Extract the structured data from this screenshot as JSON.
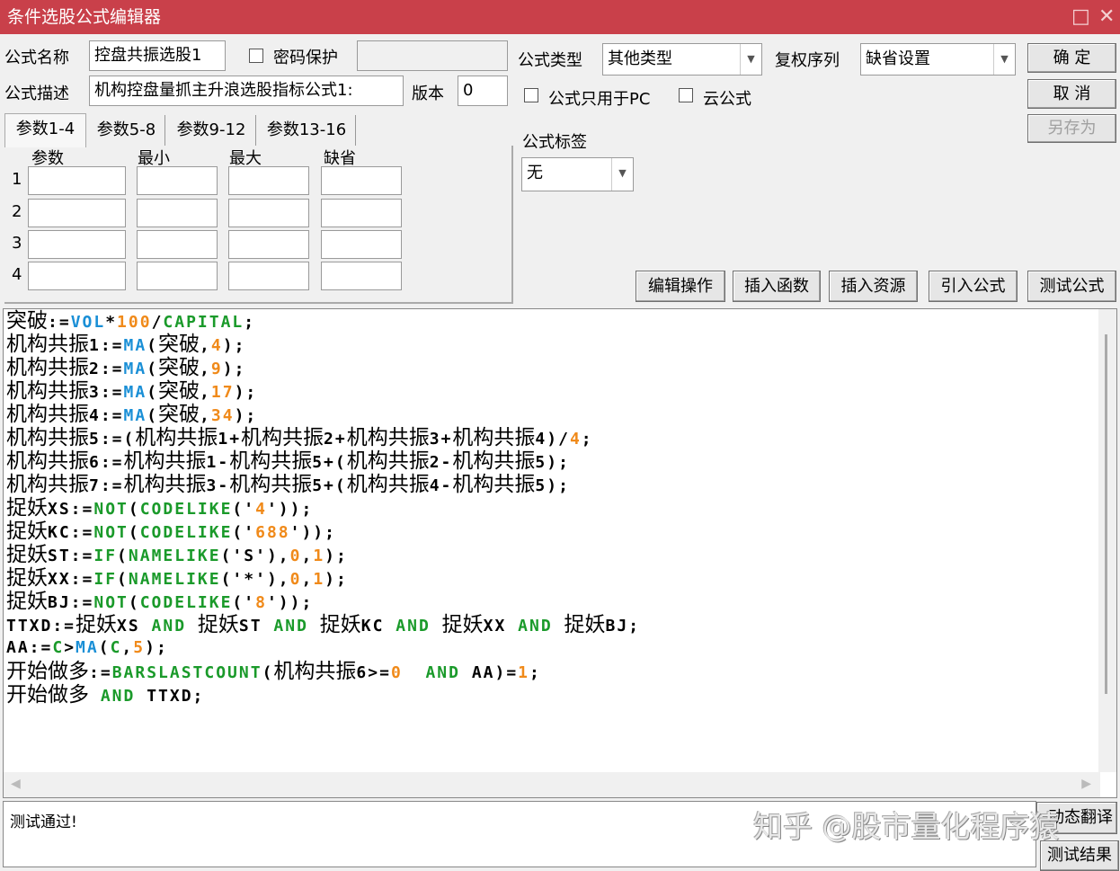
{
  "window": {
    "title": "条件选股公式编辑器",
    "restore_icon": "□",
    "close_icon": "✕"
  },
  "form": {
    "name_label": "公式名称",
    "name_value": "控盘共振选股1",
    "password_label": "密码保护",
    "password_value": "",
    "type_label": "公式类型",
    "type_value": "其他类型",
    "rights_label": "复权序列",
    "rights_value": "缺省设置",
    "desc_label": "公式描述",
    "desc_value": "机构控盘量抓主升浪选股指标公式1:",
    "version_label": "版本",
    "version_value": "0",
    "pc_only_label": "公式只用于PC",
    "cloud_label": "云公式",
    "tag_label": "公式标签",
    "tag_value": "无"
  },
  "buttons": {
    "ok": "确  定",
    "cancel": "取  消",
    "save_as": "另存为",
    "edit_ops": "编辑操作",
    "insert_func": "插入函数",
    "insert_res": "插入资源",
    "import": "引入公式",
    "test": "测试公式",
    "translate": "动态翻译",
    "test_result": "测试结果"
  },
  "tabs": [
    "参数1-4",
    "参数5-8",
    "参数9-12",
    "参数13-16"
  ],
  "params": {
    "headers": [
      "参数",
      "最小",
      "最大",
      "缺省"
    ],
    "rows": [
      "1",
      "2",
      "3",
      "4"
    ]
  },
  "colors": {
    "title_bar": "#c9404a",
    "k": "#000000",
    "b": "#1a8fd6",
    "g": "#1a9a2a",
    "o": "#f08a1a"
  },
  "code": [
    [
      [
        "突破",
        "k"
      ],
      [
        ":=",
        "k"
      ],
      [
        "VOL",
        "b"
      ],
      [
        "*",
        "k"
      ],
      [
        "100",
        "o"
      ],
      [
        "/",
        "k"
      ],
      [
        "CAPITAL",
        "g"
      ],
      [
        ";",
        "k"
      ]
    ],
    [
      [
        "机构共振",
        "k"
      ],
      [
        "1:=",
        "k"
      ],
      [
        "MA",
        "b"
      ],
      [
        "(",
        "k"
      ],
      [
        "突破",
        "k"
      ],
      [
        ",",
        "k"
      ],
      [
        "4",
        "o"
      ],
      [
        ");",
        "k"
      ]
    ],
    [
      [
        "机构共振",
        "k"
      ],
      [
        "2:=",
        "k"
      ],
      [
        "MA",
        "b"
      ],
      [
        "(",
        "k"
      ],
      [
        "突破",
        "k"
      ],
      [
        ",",
        "k"
      ],
      [
        "9",
        "o"
      ],
      [
        ");",
        "k"
      ]
    ],
    [
      [
        "机构共振",
        "k"
      ],
      [
        "3:=",
        "k"
      ],
      [
        "MA",
        "b"
      ],
      [
        "(",
        "k"
      ],
      [
        "突破",
        "k"
      ],
      [
        ",",
        "k"
      ],
      [
        "17",
        "o"
      ],
      [
        ");",
        "k"
      ]
    ],
    [
      [
        "机构共振",
        "k"
      ],
      [
        "4:=",
        "k"
      ],
      [
        "MA",
        "b"
      ],
      [
        "(",
        "k"
      ],
      [
        "突破",
        "k"
      ],
      [
        ",",
        "k"
      ],
      [
        "34",
        "o"
      ],
      [
        ");",
        "k"
      ]
    ],
    [
      [
        "机构共振",
        "k"
      ],
      [
        "5:=(",
        "k"
      ],
      [
        "机构共振",
        "k"
      ],
      [
        "1+",
        "k"
      ],
      [
        "机构共振",
        "k"
      ],
      [
        "2+",
        "k"
      ],
      [
        "机构共振",
        "k"
      ],
      [
        "3+",
        "k"
      ],
      [
        "机构共振",
        "k"
      ],
      [
        "4)/",
        "k"
      ],
      [
        "4",
        "o"
      ],
      [
        ";",
        "k"
      ]
    ],
    [
      [
        "机构共振",
        "k"
      ],
      [
        "6:=",
        "k"
      ],
      [
        "机构共振",
        "k"
      ],
      [
        "1-",
        "k"
      ],
      [
        "机构共振",
        "k"
      ],
      [
        "5+(",
        "k"
      ],
      [
        "机构共振",
        "k"
      ],
      [
        "2-",
        "k"
      ],
      [
        "机构共振",
        "k"
      ],
      [
        "5);",
        "k"
      ]
    ],
    [
      [
        "机构共振",
        "k"
      ],
      [
        "7:=",
        "k"
      ],
      [
        "机构共振",
        "k"
      ],
      [
        "3-",
        "k"
      ],
      [
        "机构共振",
        "k"
      ],
      [
        "5+(",
        "k"
      ],
      [
        "机构共振",
        "k"
      ],
      [
        "4-",
        "k"
      ],
      [
        "机构共振",
        "k"
      ],
      [
        "5);",
        "k"
      ]
    ],
    [
      [
        "捉妖",
        "k"
      ],
      [
        "XS:=",
        "k"
      ],
      [
        "NOT",
        "g"
      ],
      [
        "(",
        "k"
      ],
      [
        "CODELIKE",
        "g"
      ],
      [
        "('",
        "k"
      ],
      [
        "4",
        "o"
      ],
      [
        "'));",
        "k"
      ]
    ],
    [
      [
        "捉妖",
        "k"
      ],
      [
        "KC:=",
        "k"
      ],
      [
        "NOT",
        "g"
      ],
      [
        "(",
        "k"
      ],
      [
        "CODELIKE",
        "g"
      ],
      [
        "('",
        "k"
      ],
      [
        "688",
        "o"
      ],
      [
        "'));",
        "k"
      ]
    ],
    [
      [
        "捉妖",
        "k"
      ],
      [
        "ST:=",
        "k"
      ],
      [
        "IF",
        "g"
      ],
      [
        "(",
        "k"
      ],
      [
        "NAMELIKE",
        "g"
      ],
      [
        "('S'),",
        "k"
      ],
      [
        "0",
        "o"
      ],
      [
        ",",
        "k"
      ],
      [
        "1",
        "o"
      ],
      [
        ");",
        "k"
      ]
    ],
    [
      [
        "捉妖",
        "k"
      ],
      [
        "XX:=",
        "k"
      ],
      [
        "IF",
        "g"
      ],
      [
        "(",
        "k"
      ],
      [
        "NAMELIKE",
        "g"
      ],
      [
        "('*'),",
        "k"
      ],
      [
        "0",
        "o"
      ],
      [
        ",",
        "k"
      ],
      [
        "1",
        "o"
      ],
      [
        ");",
        "k"
      ]
    ],
    [
      [
        "捉妖",
        "k"
      ],
      [
        "BJ:=",
        "k"
      ],
      [
        "NOT",
        "g"
      ],
      [
        "(",
        "k"
      ],
      [
        "CODELIKE",
        "g"
      ],
      [
        "('",
        "k"
      ],
      [
        "8",
        "o"
      ],
      [
        "'));",
        "k"
      ]
    ],
    [
      [
        "TTXD:=",
        "k"
      ],
      [
        "捉妖",
        "k"
      ],
      [
        "XS ",
        "k"
      ],
      [
        "AND",
        "g"
      ],
      [
        " ",
        "k"
      ],
      [
        "捉妖",
        "k"
      ],
      [
        "ST ",
        "k"
      ],
      [
        "AND",
        "g"
      ],
      [
        " ",
        "k"
      ],
      [
        "捉妖",
        "k"
      ],
      [
        "KC ",
        "k"
      ],
      [
        "AND",
        "g"
      ],
      [
        " ",
        "k"
      ],
      [
        "捉妖",
        "k"
      ],
      [
        "XX ",
        "k"
      ],
      [
        "AND",
        "g"
      ],
      [
        " ",
        "k"
      ],
      [
        "捉妖",
        "k"
      ],
      [
        "BJ;",
        "k"
      ]
    ],
    [
      [
        "AA:=",
        "k"
      ],
      [
        "C",
        "g"
      ],
      [
        ">",
        "k"
      ],
      [
        "MA",
        "b"
      ],
      [
        "(",
        "k"
      ],
      [
        "C",
        "g"
      ],
      [
        ",",
        "k"
      ],
      [
        "5",
        "o"
      ],
      [
        ");",
        "k"
      ]
    ],
    [
      [
        "开始做多",
        "k"
      ],
      [
        ":=",
        "k"
      ],
      [
        "BARSLASTCOUNT",
        "g"
      ],
      [
        "(",
        "k"
      ],
      [
        "机构共振",
        "k"
      ],
      [
        "6>=",
        "k"
      ],
      [
        "0",
        "o"
      ],
      [
        "  ",
        "k"
      ],
      [
        "AND",
        "g"
      ],
      [
        " AA)=",
        "k"
      ],
      [
        "1",
        "o"
      ],
      [
        ";",
        "k"
      ]
    ],
    [
      [
        "开始做多",
        "k"
      ],
      [
        " ",
        "k"
      ],
      [
        "AND",
        "g"
      ],
      [
        " TTXD;",
        "k"
      ]
    ]
  ],
  "output": {
    "message": "测试通过!"
  },
  "watermark": "知乎 @股市量化程序猿"
}
